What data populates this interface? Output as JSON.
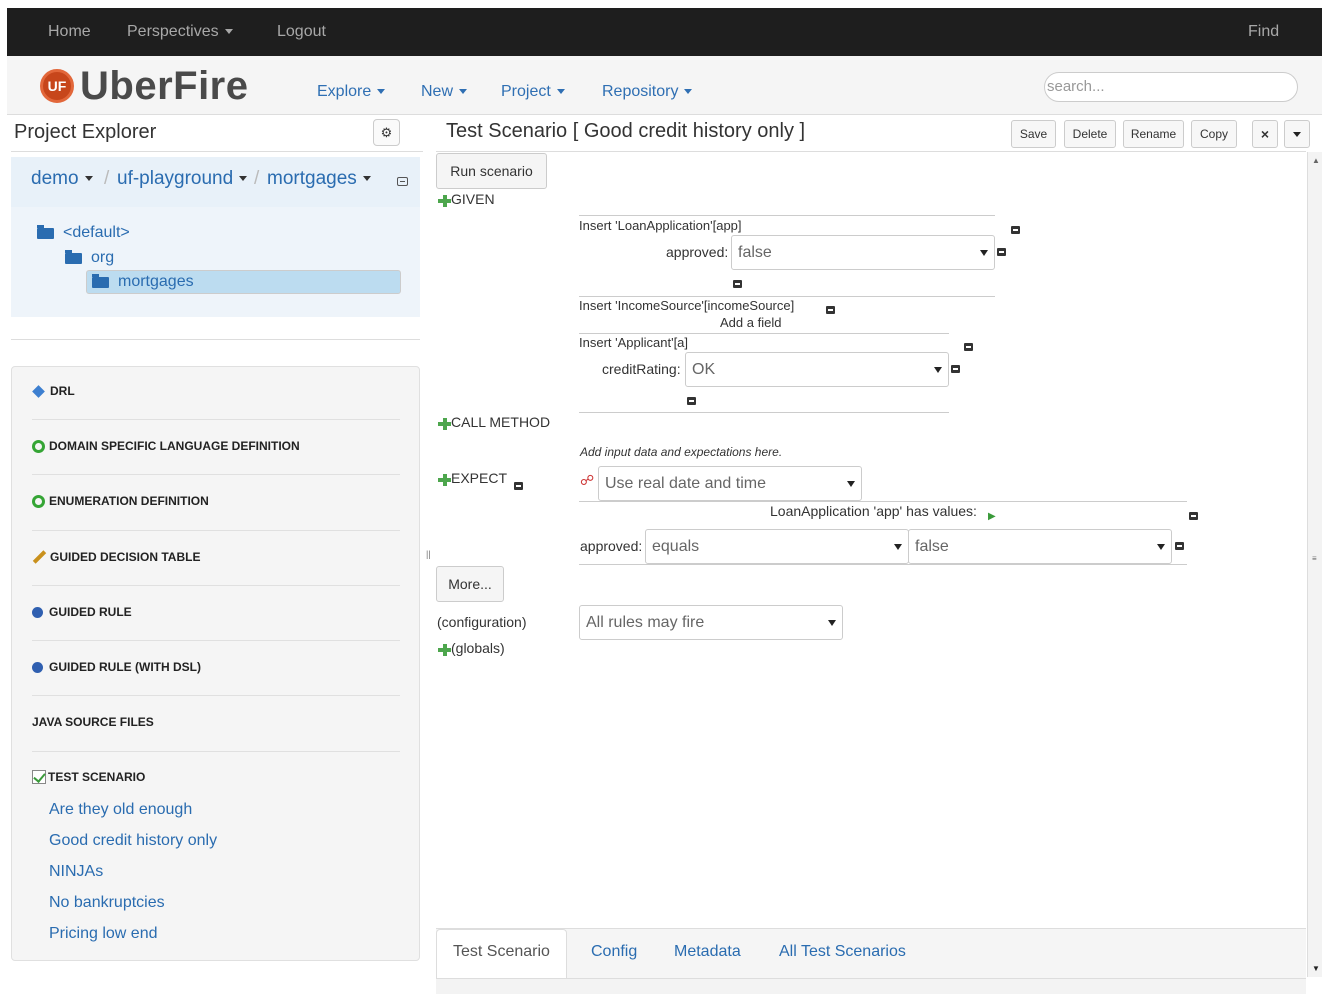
{
  "topbar": {
    "home": "Home",
    "perspectives": "Perspectives",
    "logout": "Logout",
    "find": "Find"
  },
  "brand": {
    "logo_badge": "UF",
    "name": "UberFire"
  },
  "menu": {
    "explore": "Explore",
    "new": "New",
    "project": "Project",
    "repository": "Repository"
  },
  "search": {
    "placeholder": "search..."
  },
  "explorer": {
    "title": "Project Explorer",
    "breadcrumb": {
      "org": "demo",
      "repo": "uf-playground",
      "project": "mortgages",
      "sep": "/"
    },
    "tree": {
      "default": "<default>",
      "org": "org",
      "mortgages": "mortgages"
    },
    "categories": {
      "drl": "DRL",
      "dsl": "DOMAIN SPECIFIC LANGUAGE DEFINITION",
      "enum": "ENUMERATION DEFINITION",
      "gdt": "GUIDED DECISION TABLE",
      "rule": "GUIDED RULE",
      "rule_dsl": "GUIDED RULE (WITH DSL)",
      "java": "JAVA SOURCE FILES",
      "test": "TEST SCENARIO"
    },
    "test_scenarios": [
      "Are they old enough",
      "Good credit history only",
      "NINJAs",
      "No bankruptcies",
      "Pricing low end"
    ]
  },
  "editor": {
    "title": "Test Scenario [ Good credit history only ]",
    "actions": {
      "save": "Save",
      "delete": "Delete",
      "rename": "Rename",
      "copy": "Copy",
      "close": "×"
    },
    "run": "Run scenario",
    "given": "GIVEN",
    "insert_loan": "Insert 'LoanApplication'[app]",
    "approved_label": "approved:",
    "approved_value": "false",
    "insert_income": "Insert 'IncomeSource'[incomeSource]",
    "add_field": "Add a field",
    "insert_applicant": "Insert 'Applicant'[a]",
    "credit_label": "creditRating:",
    "credit_value": "OK",
    "call_method": "CALL METHOD",
    "hint": "Add input data and expectations here.",
    "expect": "EXPECT",
    "date_mode": "Use real date and time",
    "loan_values": "LoanApplication 'app' has values:",
    "exp_label": "approved:",
    "exp_op": "equals",
    "exp_value": "false",
    "more": "More...",
    "config_label": "(configuration)",
    "config_value": "All rules may fire",
    "globals": "(globals)"
  },
  "tabs": {
    "scenario": "Test Scenario",
    "config": "Config",
    "metadata": "Metadata",
    "all": "All Test Scenarios"
  }
}
